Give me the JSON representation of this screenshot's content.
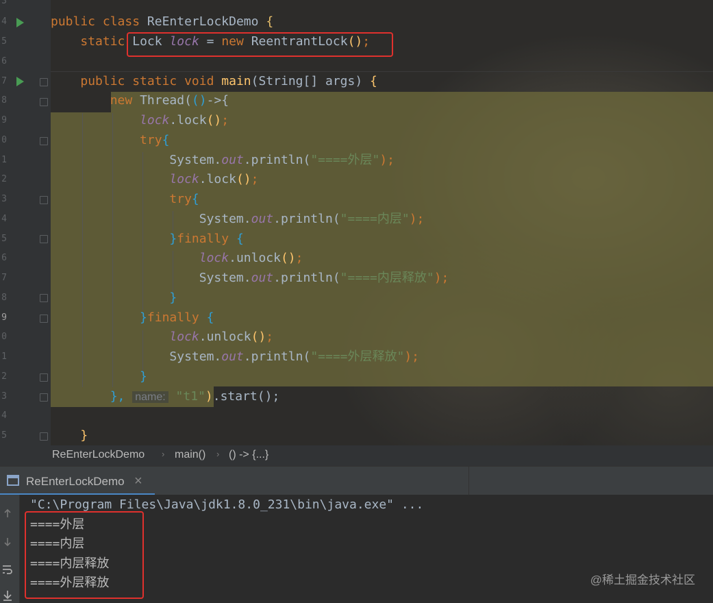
{
  "editor": {
    "line_numbers": [
      "3",
      "4",
      "5",
      "6",
      "7",
      "8",
      "9",
      "0",
      "1",
      "2",
      "3",
      "4",
      "5",
      "6",
      "7",
      "8",
      "9",
      "0",
      "1",
      "2",
      "3",
      "4",
      "5"
    ],
    "comment_end": "*/",
    "code": {
      "l4_public": "public",
      "l4_class": "class",
      "l4_name": "ReEnterLockDemo",
      "l4_brace": "{",
      "l5_static": "static",
      "l5_type": "Lock",
      "l5_field": "lock",
      "l5_eq": "=",
      "l5_new": "new",
      "l5_ctor": "ReentrantLock",
      "l5_paren": "()",
      "l5_semi": ";",
      "l7_mods": "public static void",
      "l7_main": "main",
      "l7_args": "(String[] args)",
      "l7_brace": "{",
      "l8_new": "new",
      "l8_thread": "Thread(",
      "l8_lambda": "()",
      "l8_arrow": "->{",
      "l9_lock": "lock",
      "l9_call": ".lock",
      "l9_paren": "()",
      "l9_semi": ";",
      "l10_try": "try",
      "l10_brace": "{",
      "l11_sys": "System.",
      "l11_out": "out",
      "l11_println": ".println(",
      "l11_str": "\"====外层\"",
      "l11_end": ");",
      "l12_lock": "lock",
      "l12_call": ".lock",
      "l12_paren": "()",
      "l12_semi": ";",
      "l13_try": "try",
      "l13_brace": "{",
      "l14_sys": "System.",
      "l14_out": "out",
      "l14_println": ".println(",
      "l14_str": "\"====内层\"",
      "l14_end": ");",
      "l15_close": "}",
      "l15_finally": "finally",
      "l15_brace": "{",
      "l16_lock": "lock",
      "l16_call": ".unlock",
      "l16_paren": "()",
      "l16_semi": ";",
      "l17_sys": "System.",
      "l17_out": "out",
      "l17_println": ".println(",
      "l17_str": "\"====内层释放\"",
      "l17_end": ");",
      "l18_close": "}",
      "l19_close": "}",
      "l19_finally": "finally",
      "l19_brace": "{",
      "l20_lock": "lock",
      "l20_call": ".unlock",
      "l20_paren": "()",
      "l20_semi": ";",
      "l21_sys": "System.",
      "l21_out": "out",
      "l21_println": ".println(",
      "l21_str": "\"====外层释放\"",
      "l21_end": ");",
      "l22_close": "}",
      "l23_close": "},",
      "l23_hint": "name:",
      "l23_str": "\"t1\"",
      "l23_paren": ")",
      "l23_start": ".start();",
      "l25_close": "}"
    }
  },
  "breadcrumb": {
    "items": [
      "ReEnterLockDemo",
      "main()",
      "() -> {...}"
    ],
    "separator": "›"
  },
  "run_tab": {
    "label": "ReEnterLockDemo",
    "close": "×"
  },
  "console": {
    "command": "\"C:\\Program Files\\Java\\jdk1.8.0_231\\bin\\java.exe\" ...",
    "output": [
      "====外层",
      "====内层",
      "====内层释放",
      "====外层释放"
    ]
  },
  "watermark": "@稀土掘金技术社区",
  "colors": {
    "keyword": "#cc7832",
    "method": "#ffc66d",
    "field": "#9876aa",
    "string": "#6a8759",
    "highlight_box": "#e0312d",
    "run_icon": "#499c54"
  }
}
